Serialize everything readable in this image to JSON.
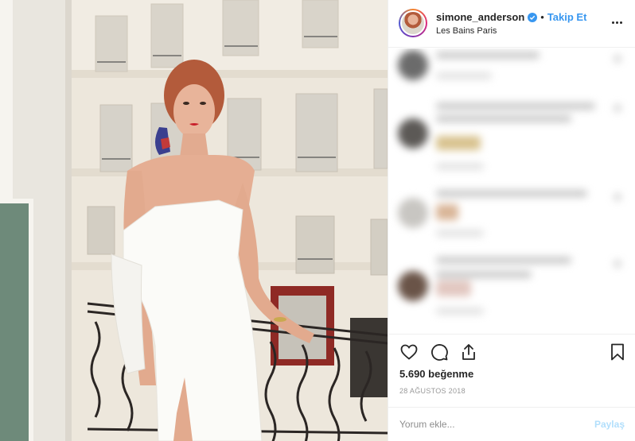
{
  "post": {
    "username": "simone_anderson",
    "verified": true,
    "separator": "•",
    "follow_label": "Takip Et",
    "location": "Les Bains Paris",
    "more_icon": "more-options-icon",
    "likes": "5.690 beğenme",
    "date": "28 AĞUSTOS 2018"
  },
  "actions": {
    "like_icon": "heart-icon",
    "comment_icon": "comment-icon",
    "share_icon": "share-icon",
    "save_icon": "bookmark-icon"
  },
  "comment_form": {
    "placeholder": "Yorum ekle...",
    "post_label": "Paylaş"
  },
  "colors": {
    "link_blue": "#3897f0",
    "post_button_disabled": "#b2dffc",
    "border": "#efefef",
    "dress": "#fbfbf8",
    "hair": "#b35b3b"
  }
}
